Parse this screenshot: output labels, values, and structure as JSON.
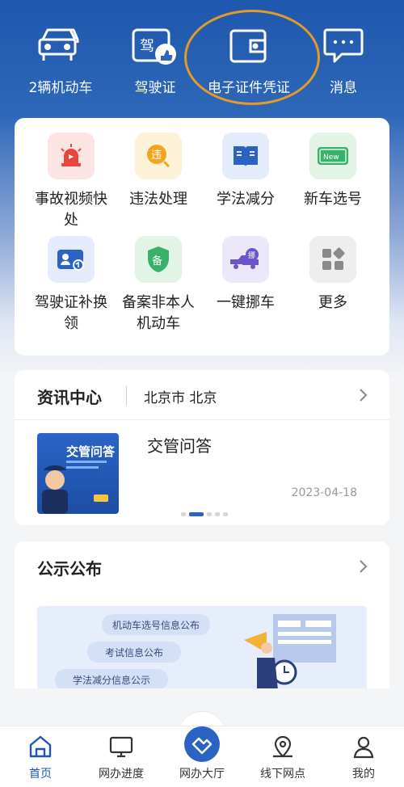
{
  "top_nav": {
    "items": [
      {
        "label": "2辆机动车",
        "icon": "car-icon"
      },
      {
        "label": "驾驶证",
        "icon": "license-icon"
      },
      {
        "label": "电子证件凭证",
        "icon": "wallet-icon"
      },
      {
        "label": "消息",
        "icon": "message-icon"
      }
    ],
    "highlight_color": "#e39a2a"
  },
  "services": {
    "items": [
      {
        "label": "事故视频快处",
        "icon": "alarm-icon",
        "tile_color": "#fde4e4"
      },
      {
        "label": "违法处理",
        "icon": "violation-icon",
        "tile_color": "#fdf1d8"
      },
      {
        "label": "学法减分",
        "icon": "book-icon",
        "tile_color": "#e4ecfb"
      },
      {
        "label": "新车选号",
        "icon": "new-plate-icon",
        "tile_color": "#e1f4e6"
      },
      {
        "label": "驾驶证补换领",
        "icon": "id-card-icon",
        "tile_color": "#e4ecfb"
      },
      {
        "label": "备案非本人机动车",
        "icon": "shield-icon",
        "tile_color": "#e1f4e6"
      },
      {
        "label": "一键挪车",
        "icon": "tow-truck-icon",
        "tile_color": "#ebe6f8"
      },
      {
        "label": "更多",
        "icon": "more-grid-icon",
        "tile_color": "#eeeeee"
      }
    ]
  },
  "news": {
    "title": "资讯中心",
    "city": "北京市 北京",
    "item": {
      "title": "交管问答",
      "date": "2023-04-18",
      "thumb_text": "交管问答"
    },
    "pager": {
      "count": 5,
      "active": 1
    }
  },
  "notice": {
    "title": "公示公布",
    "banner": {
      "pills": [
        "机动车选号信息公布",
        "考试信息公布",
        "学法减分信息公示"
      ]
    }
  },
  "tabbar": {
    "items": [
      {
        "label": "首页",
        "icon": "home-icon",
        "active": true
      },
      {
        "label": "网办进度",
        "icon": "monitor-icon",
        "active": false
      },
      {
        "label": "网办大厅",
        "icon": "hall-icon",
        "active": false
      },
      {
        "label": "线下网点",
        "icon": "location-pin-icon",
        "active": false
      },
      {
        "label": "我的",
        "icon": "user-icon",
        "active": false
      }
    ],
    "active_color": "#1d56b5"
  },
  "colors": {
    "primary": "#1f57ad",
    "accent": "#2b63c4"
  }
}
